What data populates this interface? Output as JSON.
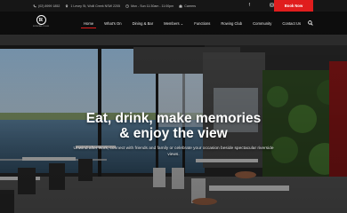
{
  "topbar": {
    "phone": "(02) 8999 1852",
    "address": "1 Levey St, Wolli Creek NSW 2205",
    "hours": "Mon - Sun 11:30am - 11:00pm",
    "careers": "Careers",
    "social": [
      "facebook-icon",
      "instagram-icon"
    ],
    "book_now": "Book Now"
  },
  "logo": {
    "letter": "R",
    "subtext": "ROWING CLUB"
  },
  "nav": {
    "items": [
      "Home",
      "What's On",
      "Dining & Bar",
      "Members ⌄",
      "Functions",
      "Rowing Club",
      "Community",
      "Contact Us"
    ],
    "active": "Home"
  },
  "hero": {
    "headline_line1": "Eat, drink, make memories",
    "headline_line2": "& enjoy the view",
    "subtext": "Unwind after work, connect with friends and family or celebrate your occasion beside spectacular riverside views."
  },
  "colors": {
    "accent": "#e01d1d",
    "topbar_bg": "#161616",
    "nav_bg": "#0d0d0d"
  }
}
